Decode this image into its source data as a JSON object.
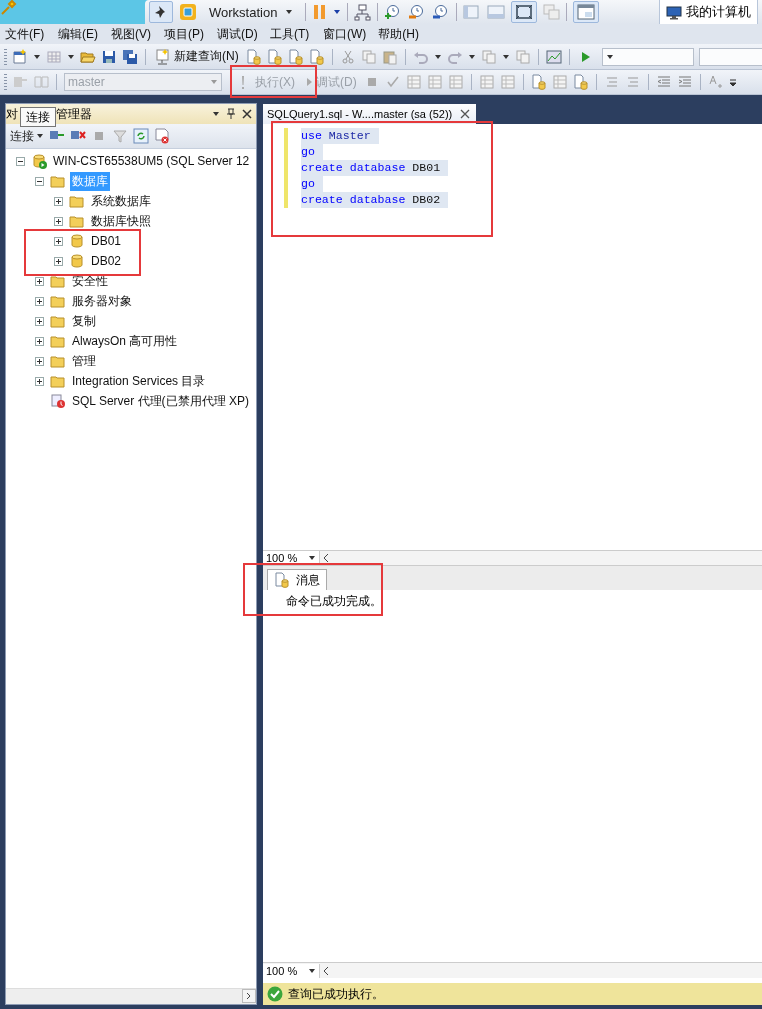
{
  "vm_toolbar": {
    "product": "Workstation",
    "tab": "我的计算机",
    "tab_selected": true
  },
  "menu": [
    "文件(F)",
    "编辑(E)",
    "视图(V)",
    "项目(P)",
    "调试(D)",
    "工具(T)",
    "窗口(W)",
    "帮助(H)"
  ],
  "toolbar1": {
    "new_query": "新建查询(N)"
  },
  "toolbar2": {
    "database": {
      "value": "master",
      "disabled": true
    },
    "execute": {
      "label": "执行(X)",
      "disabled": true
    },
    "debug": {
      "label": "调试(D)",
      "disabled": true
    }
  },
  "explorer": {
    "title_start": "对",
    "title_end": "管理器",
    "tooltip": "连接",
    "connect": "连接",
    "tree": [
      {
        "label": "WIN-CST65538UM5 (SQL Server 12",
        "kind": "server",
        "expanded": true,
        "selected": false,
        "children": [
          {
            "label": "数据库",
            "kind": "folder",
            "expanded": true,
            "selected": true,
            "children": [
              {
                "label": "系统数据库",
                "kind": "folder",
                "expanded": false,
                "selected": false
              },
              {
                "label": "数据库快照",
                "kind": "folder",
                "expanded": false,
                "selected": false
              },
              {
                "label": "DB01",
                "kind": "database",
                "expanded": false,
                "selected": false
              },
              {
                "label": "DB02",
                "kind": "database",
                "expanded": false,
                "selected": false
              }
            ]
          },
          {
            "label": "安全性",
            "kind": "folder",
            "expanded": false,
            "selected": false
          },
          {
            "label": "服务器对象",
            "kind": "folder",
            "expanded": false,
            "selected": false
          },
          {
            "label": "复制",
            "kind": "folder",
            "expanded": false,
            "selected": false
          },
          {
            "label": "AlwaysOn 高可用性",
            "kind": "folder",
            "expanded": false,
            "selected": false
          },
          {
            "label": "管理",
            "kind": "folder",
            "expanded": false,
            "selected": false
          },
          {
            "label": "Integration Services 目录",
            "kind": "folder",
            "expanded": false,
            "selected": false
          },
          {
            "label": "SQL Server 代理(已禁用代理 XP)",
            "kind": "agent",
            "selected": false
          }
        ]
      }
    ]
  },
  "document_tab": {
    "title": "SQLQuery1.sql - W....master (sa (52))",
    "selected": true
  },
  "editor": {
    "lines": [
      {
        "selected": true,
        "tokens": [
          {
            "kind": "keyword",
            "text": "use"
          },
          {
            "kind": "identifier",
            "text": "Master"
          }
        ]
      },
      {
        "selected": true,
        "tokens": [
          {
            "kind": "keyword",
            "text": "go"
          }
        ]
      },
      {
        "selected": true,
        "tokens": [
          {
            "kind": "keyword",
            "text": "create"
          },
          {
            "kind": "keyword",
            "text": "database"
          },
          {
            "kind": "plain",
            "text": "DB01"
          }
        ]
      },
      {
        "selected": true,
        "tokens": [
          {
            "kind": "keyword",
            "text": "go"
          }
        ]
      },
      {
        "selected": true,
        "tokens": [
          {
            "kind": "keyword",
            "text": "create"
          },
          {
            "kind": "keyword",
            "text": "database"
          },
          {
            "kind": "plain",
            "text": "DB02"
          }
        ]
      }
    ],
    "zoom": "100 %"
  },
  "results": {
    "tab": "消息",
    "tab_selected": true,
    "message": "命令已成功完成。",
    "zoom": "100 %"
  },
  "status_bar": {
    "kind": "success",
    "text": "查询已成功执行。"
  },
  "annotations": [
    {
      "kind": "red_frame"
    },
    {
      "kind": "red_frame"
    },
    {
      "kind": "red_frame"
    },
    {
      "kind": "red_frame"
    }
  ]
}
